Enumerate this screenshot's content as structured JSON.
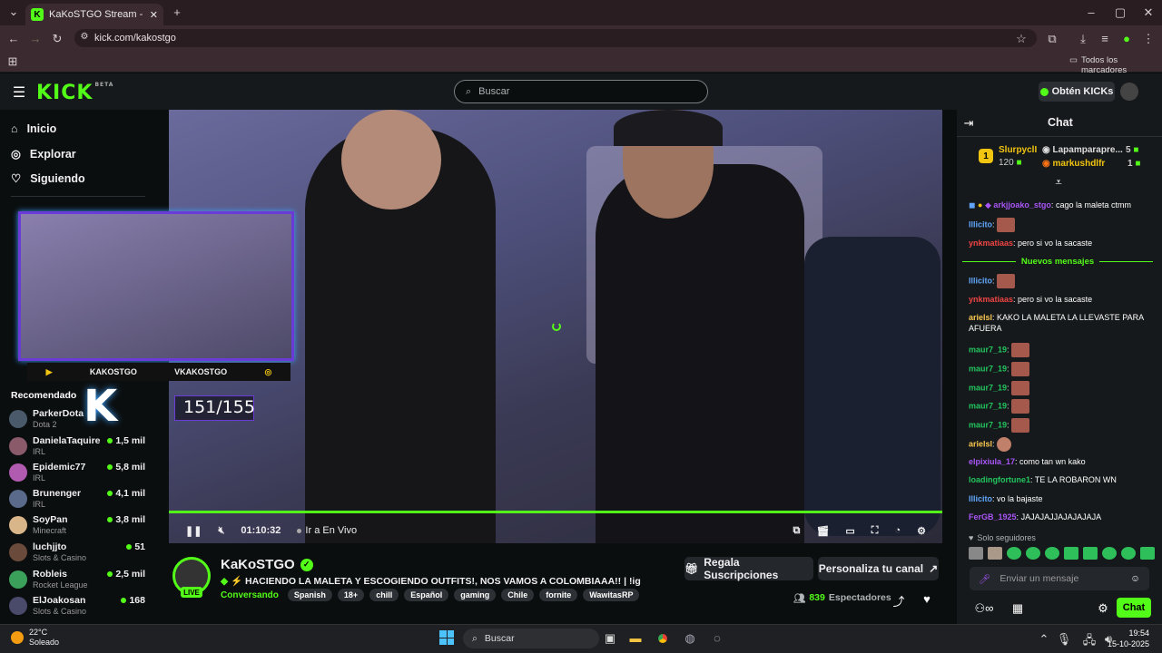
{
  "browser": {
    "tab_title": "KaKoSTGO Stream - Watch Live",
    "url": "kick.com/kakostgo",
    "bookmarks_label": "Todos los marcadores"
  },
  "header": {
    "logo": "KICK",
    "logo_badge": "BETA",
    "search_placeholder": "Buscar",
    "get_kicks": "Obtén KICKs"
  },
  "sidebar": {
    "nav": [
      {
        "label": "Inicio",
        "icon": "home-icon"
      },
      {
        "label": "Explorar",
        "icon": "compass-icon"
      },
      {
        "label": "Siguiendo",
        "icon": "heart-icon"
      }
    ],
    "recommended_title": "Recomendado",
    "recommended": [
      {
        "name": "ParkerDota",
        "category": "Dota 2",
        "viewers": ""
      },
      {
        "name": "DanielaTaquire",
        "category": "IRL",
        "viewers": "1,5 mil"
      },
      {
        "name": "Epidemic77",
        "category": "IRL",
        "viewers": "5,8 mil"
      },
      {
        "name": "Brunenger",
        "category": "IRL",
        "viewers": "4,1 mil"
      },
      {
        "name": "SoyPan",
        "category": "Minecraft",
        "viewers": "3,8 mil"
      },
      {
        "name": "luchjjto",
        "category": "Slots & Casino",
        "viewers": "51"
      },
      {
        "name": "Robleis",
        "category": "Rocket League",
        "viewers": "2,5 mil"
      },
      {
        "name": "ElJoakosan",
        "category": "Slots & Casino",
        "viewers": "168"
      }
    ]
  },
  "video": {
    "overlay_left": "KAKOSTGO",
    "overlay_right": "VKAKOSTGO",
    "sub_counter": "151/155",
    "time": "01:10:32",
    "go_live": "Ir a En Vivo"
  },
  "channel": {
    "name": "KaKoSTGO",
    "live_badge": "LIVE",
    "title": "HACIENDO LA MALETA Y ESCOGIENDO OUTFITS!, NOS VAMOS A COLOMBIAAA!! | !ig",
    "category": "Conversando",
    "tags": [
      "Spanish",
      "18+",
      "chill",
      "Español",
      "gaming",
      "Chile",
      "fornite",
      "WawitasRP"
    ],
    "gift_subs": "Regala Suscripciones",
    "customize": "Personaliza tu canal",
    "viewer_count": "839",
    "viewer_label": "Espectadores"
  },
  "chat": {
    "title": "Chat",
    "leaderboard": [
      {
        "rank": "1",
        "name": "SlurpyclI",
        "value": "120"
      },
      {
        "name": "Lapamparapre...",
        "value": "5"
      },
      {
        "name": "markushdlfr",
        "value": "1"
      }
    ],
    "new_messages": "Nuevos mensajes",
    "followers_only": "Solo seguidores",
    "input_placeholder": "Enviar un mensaje",
    "send_label": "Chat",
    "messages_before": [
      {
        "user": "arkjjoako_stgo",
        "color": "#a855f7",
        "text": "cago la maleta ctmm"
      },
      {
        "user": "Illicito",
        "color": "#60a5fa",
        "text": "",
        "emote": true
      },
      {
        "user": "ynkmatiaas",
        "color": "#ef4444",
        "text": "pero si vo la sacaste"
      }
    ],
    "messages_after": [
      {
        "user": "Illicito",
        "color": "#60a5fa",
        "text": "",
        "emote": true
      },
      {
        "user": "ynkmatiaas",
        "color": "#ef4444",
        "text": "pero si vo la sacaste"
      },
      {
        "user": "arielsl",
        "color": "#f9c74f",
        "text": "KAKO LA MALETA LA LLEVASTE PARA AFUERA"
      },
      {
        "user": "maur7_19",
        "color": "#22c55e",
        "text": "",
        "emote": true
      },
      {
        "user": "maur7_19",
        "color": "#22c55e",
        "text": "",
        "emote": true
      },
      {
        "user": "maur7_19",
        "color": "#22c55e",
        "text": "",
        "emote": true
      },
      {
        "user": "maur7_19",
        "color": "#22c55e",
        "text": "",
        "emote": true
      },
      {
        "user": "maur7_19",
        "color": "#22c55e",
        "text": "",
        "emote": true
      },
      {
        "user": "arielsl",
        "color": "#f9c74f",
        "text": "",
        "emote": true
      },
      {
        "user": "elpixiula_17",
        "color": "#a855f7",
        "text": "como tan wn kako"
      },
      {
        "user": "loadingfortune1",
        "color": "#22c55e",
        "text": "TE LA ROBARON WN"
      },
      {
        "user": "Illicito",
        "color": "#60a5fa",
        "text": "vo la bajaste"
      },
      {
        "user": "FerGB_1925",
        "color": "#a855f7",
        "text": "JAJAJAJJAJAJAJAJA"
      }
    ]
  },
  "taskbar": {
    "temp": "22°C",
    "weather": "Soleado",
    "search": "Buscar",
    "time": "19:54",
    "date": "15-10-2025"
  },
  "colors": {
    "accent": "#53fc18",
    "bg": "#0b0e0f",
    "panel": "#16191b"
  }
}
